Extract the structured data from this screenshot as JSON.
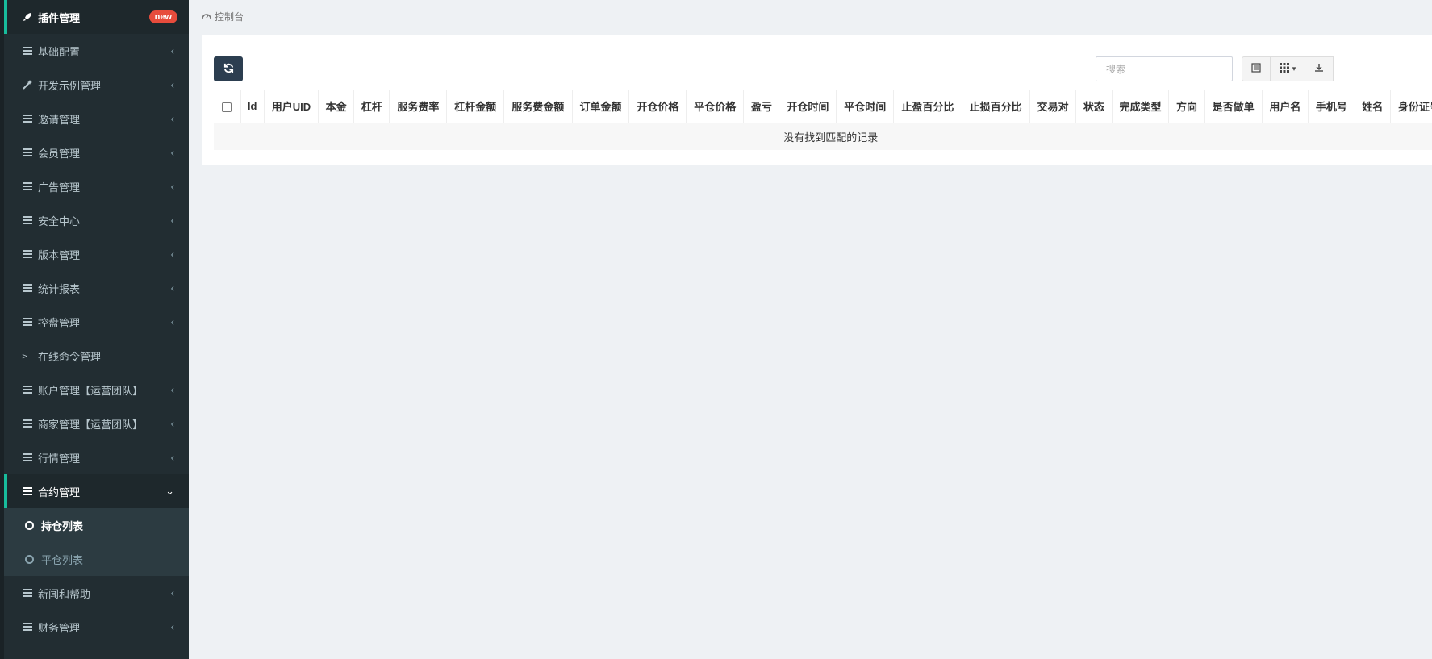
{
  "sidebar": {
    "items": [
      {
        "label": "插件管理",
        "icon": "rocket-icon",
        "badge": "new"
      },
      {
        "label": "基础配置",
        "icon": "list-icon"
      },
      {
        "label": "开发示例管理",
        "icon": "magic-icon"
      },
      {
        "label": "邀请管理",
        "icon": "list-icon"
      },
      {
        "label": "会员管理",
        "icon": "list-icon"
      },
      {
        "label": "广告管理",
        "icon": "list-icon"
      },
      {
        "label": "安全中心",
        "icon": "list-icon"
      },
      {
        "label": "版本管理",
        "icon": "list-icon"
      },
      {
        "label": "统计报表",
        "icon": "list-icon"
      },
      {
        "label": "控盘管理",
        "icon": "list-icon"
      },
      {
        "label": "在线命令管理",
        "icon": "terminal-icon"
      },
      {
        "label": "账户管理【运营团队】",
        "icon": "list-icon"
      },
      {
        "label": "商家管理【运营团队】",
        "icon": "list-icon"
      },
      {
        "label": "行情管理",
        "icon": "list-icon"
      },
      {
        "label": "合约管理",
        "icon": "list-icon"
      }
    ],
    "sub_items": [
      {
        "label": "持仓列表"
      },
      {
        "label": "平仓列表"
      }
    ],
    "bottom_items": [
      {
        "label": "新闻和帮助",
        "icon": "list-icon"
      },
      {
        "label": "财务管理",
        "icon": "list-icon"
      }
    ]
  },
  "breadcrumb": {
    "label": "控制台",
    "icon": "dashboard-icon"
  },
  "toolbar": {
    "refresh_icon": "refresh-icon",
    "search_placeholder": "搜索"
  },
  "table": {
    "columns": [
      "Id",
      "用户UID",
      "本金",
      "杠杆",
      "服务费率",
      "杠杆金额",
      "服务费金额",
      "订单金额",
      "开仓价格",
      "平仓价格",
      "盈亏",
      "开仓时间",
      "平仓时间",
      "止盈百分比",
      "止损百分比",
      "交易对",
      "状态",
      "完成类型",
      "方向",
      "是否做单",
      "用户名",
      "手机号",
      "姓名",
      "身份证号"
    ],
    "empty_text": "没有找到匹配的记录"
  },
  "colors": {
    "sidebar_bg": "#222d32",
    "accent": "#18bc9c",
    "badge": "#e74c3c",
    "button_dark": "#2c3e50"
  }
}
